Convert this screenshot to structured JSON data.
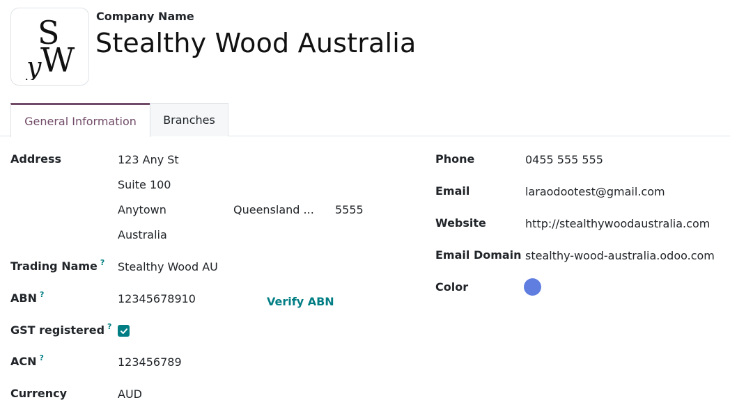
{
  "header": {
    "name_label": "Company Name",
    "company_name": "Stealthy Wood Australia",
    "logo_icon": "sw-monogram-logo"
  },
  "tabs": [
    {
      "label": "General Information",
      "active": true
    },
    {
      "label": "Branches",
      "active": false
    }
  ],
  "left_fields": {
    "address": {
      "label": "Address",
      "street": "123 Any St",
      "street2": "Suite 100",
      "city": "Anytown",
      "state": "Queensland ...",
      "zip": "5555",
      "country": "Australia"
    },
    "trading_name": {
      "label": "Trading Name",
      "help": "?",
      "value": "Stealthy Wood AU"
    },
    "abn": {
      "label": "ABN",
      "help": "?",
      "value": "12345678910",
      "action": "Verify ABN"
    },
    "gst_registered": {
      "label": "GST registered",
      "help": "?",
      "checked": true
    },
    "acn": {
      "label": "ACN",
      "help": "?",
      "value": "123456789"
    },
    "currency": {
      "label": "Currency",
      "value": "AUD"
    }
  },
  "right_fields": {
    "phone": {
      "label": "Phone",
      "value": "0455 555 555"
    },
    "email": {
      "label": "Email",
      "value": "laraodootest@gmail.com"
    },
    "website": {
      "label": "Website",
      "value": "http://stealthywoodaustralia.com"
    },
    "email_domain": {
      "label": "Email Domain",
      "value": "stealthy-wood-australia.odoo.com"
    },
    "color": {
      "label": "Color",
      "value_hex": "#5f7ee0"
    }
  },
  "colors": {
    "accent": "#714b67",
    "link": "#017e84"
  }
}
